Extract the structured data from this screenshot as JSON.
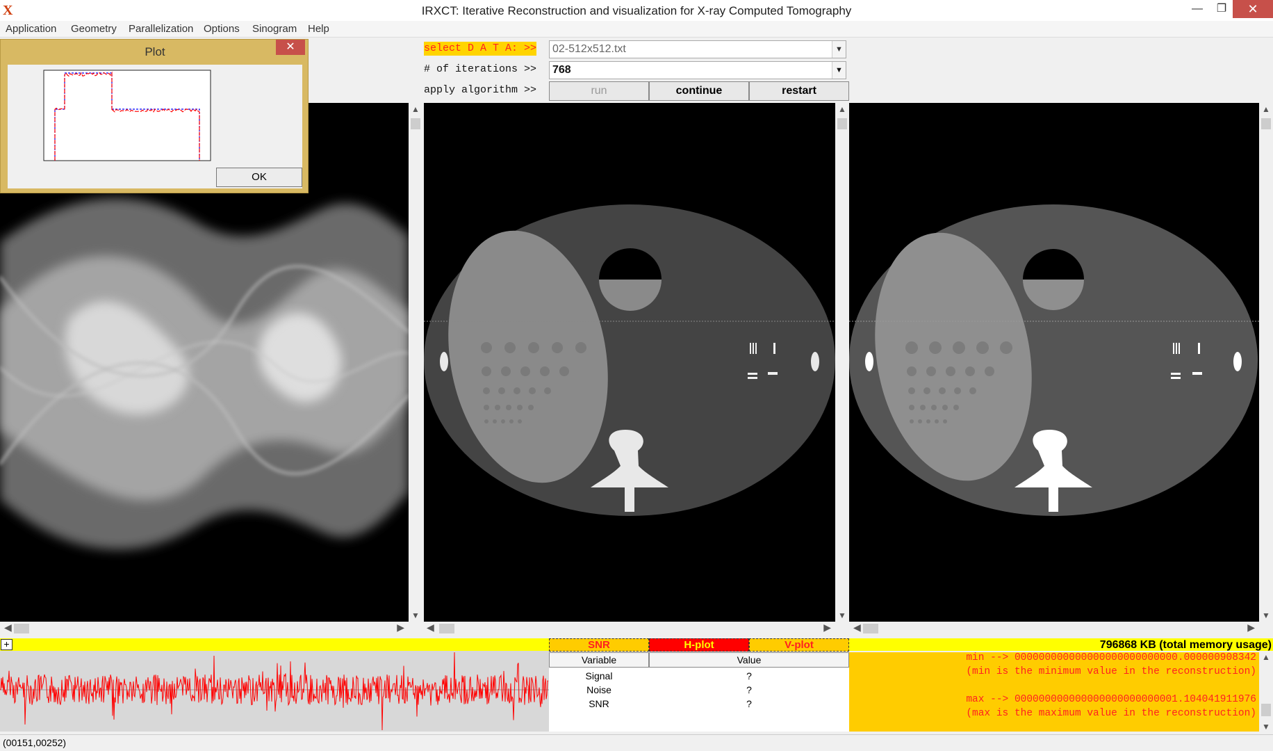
{
  "window": {
    "icon_glyph": "X",
    "title": "IRXCT: Iterative Reconstruction and visualization for X-ray Computed Tomography",
    "minimize_glyph": "—",
    "maximize_glyph": "❐",
    "close_glyph": "✕"
  },
  "menu": [
    "Application",
    "Geometry",
    "Parallelization",
    "Options",
    "Sinogram",
    "Help"
  ],
  "controls": {
    "select_label": "select D A T A: >>",
    "data_file": "02-512x512.txt",
    "iterations_label": "# of iterations >>",
    "iterations_value": "768",
    "apply_label": "apply algorithm >>",
    "run_label": "run",
    "continue_label": "continue",
    "restart_label": "restart"
  },
  "plot_dialog": {
    "title": "Plot",
    "close_glyph": "✕",
    "ok_label": "OK"
  },
  "tabs": {
    "snr": "SNR",
    "hplot": "H-plot",
    "vplot": "V-plot",
    "expand_glyph": "+"
  },
  "memory_usage": "796868 KB (total memory usage)",
  "table": {
    "headers": [
      "Variable",
      "Value"
    ],
    "rows": [
      {
        "variable": "Signal",
        "value": "?"
      },
      {
        "variable": "Noise",
        "value": "?"
      },
      {
        "variable": "SNR",
        "value": "?"
      }
    ]
  },
  "console": {
    "line1": "min --> 000000000000000000000000000.000000908342",
    "line2": "(min is the minimum value in the reconstruction)",
    "line3": "max --> 000000000000000000000000001.104041911976",
    "line4": "(max is the maximum value in the reconstruction)"
  },
  "status": "(00151,00252)",
  "colors": {
    "accent_yellow": "#ffff00",
    "console_bg": "#ffcc00",
    "hplot_red": "#ff0000",
    "plot_line_red": "#ff0000",
    "plot_line_blue": "#0000ff"
  }
}
